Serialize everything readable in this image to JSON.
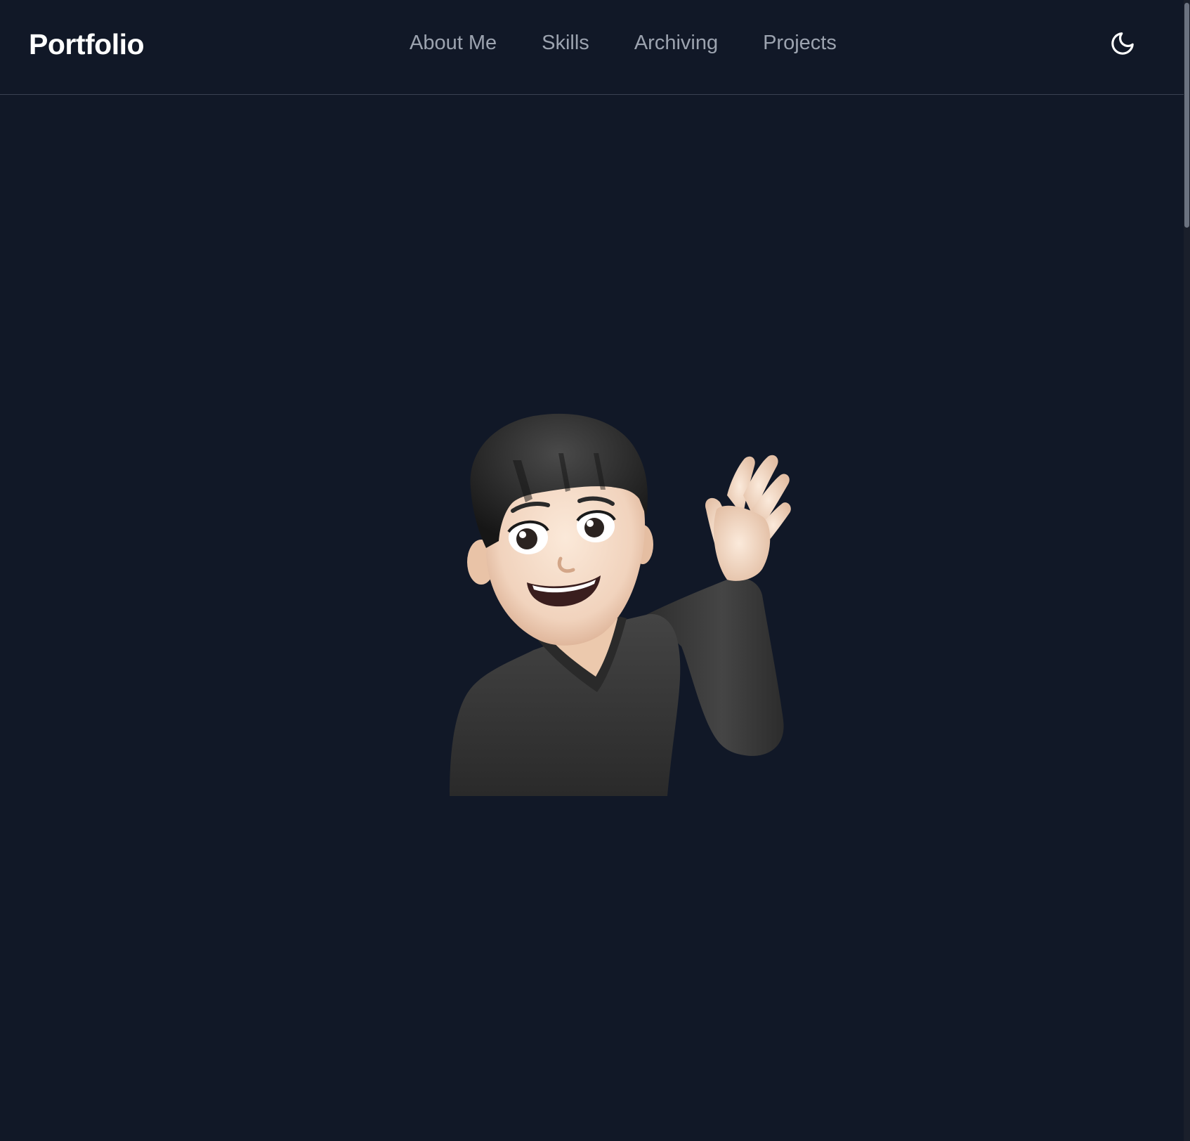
{
  "header": {
    "brand": "Portfolio",
    "nav": [
      {
        "label": "About Me"
      },
      {
        "label": "Skills"
      },
      {
        "label": "Archiving"
      },
      {
        "label": "Projects"
      }
    ],
    "theme_toggle_icon": "moon-icon"
  },
  "hero": {
    "avatar_icon": "waving-memoji-avatar"
  },
  "colors": {
    "background": "#111827",
    "nav_text": "#9ca3af",
    "brand_text": "#ffffff",
    "divider": "#3b4252"
  }
}
